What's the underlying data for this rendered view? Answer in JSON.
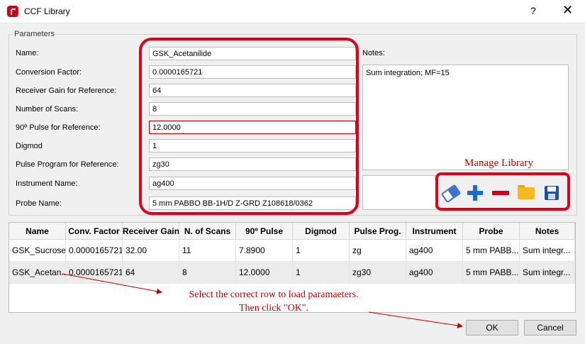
{
  "window": {
    "title": "CCF Library",
    "help_glyph": "?",
    "close_glyph": "✕"
  },
  "parameters": {
    "group_title": "Parameters",
    "fields": [
      {
        "label": "Name:",
        "value": "GSK_Acetanilide"
      },
      {
        "label": "Conversion Factor:",
        "value": "0.0000165721"
      },
      {
        "label": "Receiver Gain for Reference:",
        "value": "64"
      },
      {
        "label": "Number of Scans:",
        "value": "8"
      },
      {
        "label": "90º Pulse for Reference:",
        "value": "12.0000"
      },
      {
        "label": "Digmod",
        "value": "1"
      },
      {
        "label": "Pulse Program for Reference:",
        "value": "zg30"
      },
      {
        "label": "Instrument Name:",
        "value": "ag400"
      },
      {
        "label": "Probe Name:",
        "value": "5 mm PABBO BB-1H/D Z-GRD Z108618/0362"
      }
    ],
    "notes_label": "Notes:",
    "notes_value": "Sum integration; MF=15"
  },
  "manage": {
    "label": "Manage Library",
    "icons": [
      "eraser-icon",
      "plus-icon",
      "minus-icon",
      "folder-icon",
      "save-icon"
    ]
  },
  "table": {
    "headers": [
      "Name",
      "Conv. Factor",
      "Receiver Gain",
      "N. of Scans",
      "90º Pulse",
      "Digmod",
      "Pulse Prog.",
      "Instrument",
      "Probe",
      "Notes"
    ],
    "rows": [
      [
        "GSK_Sucrose",
        "0.0000165721",
        "32.00",
        "11",
        "7.8900",
        "1",
        "zg",
        "ag400",
        "5 mm PABB...",
        "Sum integr..."
      ],
      [
        "GSK_Acetan...",
        "0.0000165721",
        "64",
        "8",
        "12.0000",
        "1",
        "zg30",
        "ag400",
        "5 mm PABB...",
        "Sum integr..."
      ]
    ]
  },
  "instructions": {
    "line1": "Select the correct row to load paramaeters.",
    "line2": "Then click \"OK\"."
  },
  "buttons": {
    "ok": "OK",
    "cancel": "Cancel"
  },
  "colors": {
    "annotation": "#e0001b",
    "annotation_text": "#c00000",
    "plus": "#1a6bd1",
    "minus": "#d0021b",
    "folder": "#f5b921",
    "disk": "#1f4fa3"
  }
}
